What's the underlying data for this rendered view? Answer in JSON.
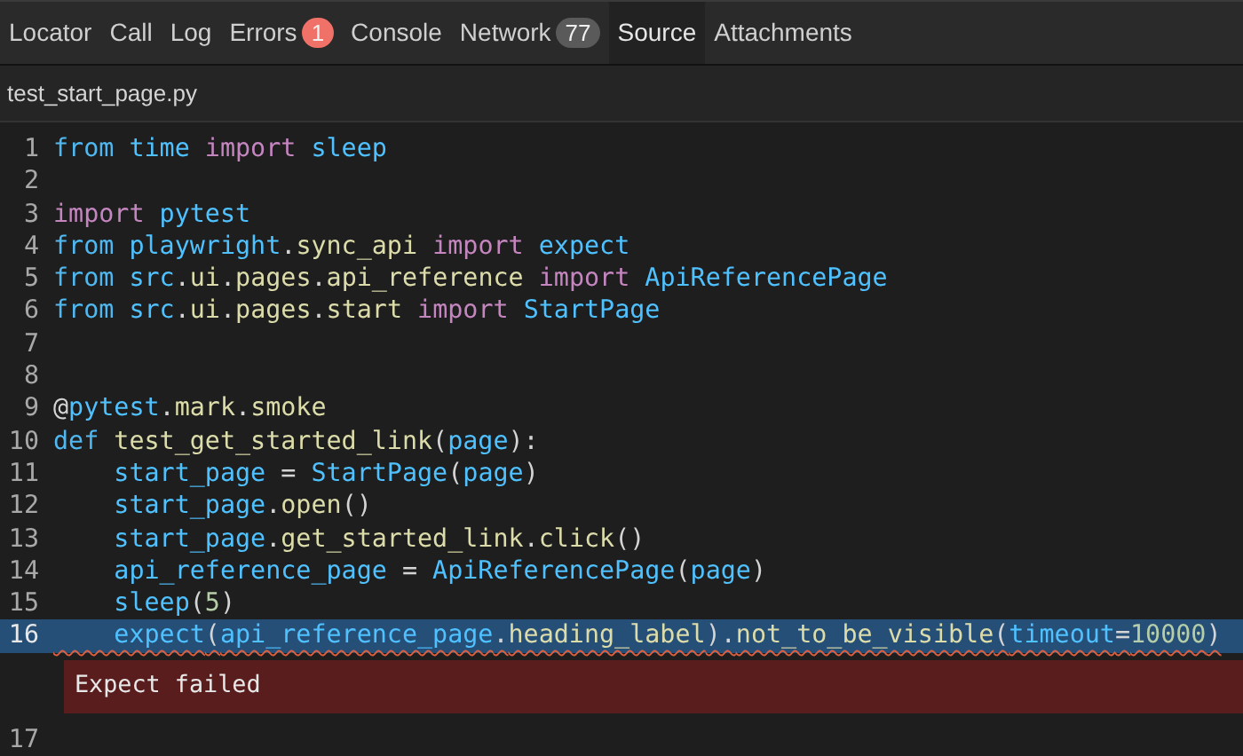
{
  "tabs": [
    {
      "label": "Locator",
      "selected": false
    },
    {
      "label": "Call",
      "selected": false
    },
    {
      "label": "Log",
      "selected": false
    },
    {
      "label": "Errors",
      "selected": false,
      "badge": {
        "text": "1",
        "color": "#f07167"
      }
    },
    {
      "label": "Console",
      "selected": false
    },
    {
      "label": "Network",
      "selected": false,
      "badge": {
        "text": "77",
        "color": "#5a5a5a"
      }
    },
    {
      "label": "Source",
      "selected": true
    },
    {
      "label": "Attachments",
      "selected": false
    }
  ],
  "file_name": "test_start_page.py",
  "lines": [
    {
      "number": "1",
      "highlighted": false,
      "tokens": [
        {
          "kind": "kw",
          "text": "from"
        },
        {
          "kind": "id",
          "text": " time"
        },
        {
          "kind": "imp",
          "text": " import"
        },
        {
          "kind": "id",
          "text": " sleep"
        }
      ]
    },
    {
      "number": "2",
      "highlighted": false
    },
    {
      "number": "3",
      "highlighted": false,
      "tokens": [
        {
          "kind": "imp",
          "text": "import"
        },
        {
          "kind": "id",
          "text": " pytest"
        }
      ]
    },
    {
      "number": "4",
      "highlighted": false,
      "tokens": [
        {
          "kind": "kw",
          "text": "from"
        },
        {
          "kind": "id",
          "text": " playwright"
        },
        {
          "kind": "plain",
          "text": "."
        },
        {
          "kind": "fn",
          "text": "sync_api"
        },
        {
          "kind": "imp",
          "text": " import"
        },
        {
          "kind": "id",
          "text": " expect"
        }
      ]
    },
    {
      "number": "5",
      "highlighted": false,
      "tokens": [
        {
          "kind": "kw",
          "text": "from"
        },
        {
          "kind": "id",
          "text": " src"
        },
        {
          "kind": "plain",
          "text": "."
        },
        {
          "kind": "fn",
          "text": "ui"
        },
        {
          "kind": "plain",
          "text": "."
        },
        {
          "kind": "fn",
          "text": "pages"
        },
        {
          "kind": "plain",
          "text": "."
        },
        {
          "kind": "fn",
          "text": "api_reference"
        },
        {
          "kind": "imp",
          "text": " import"
        },
        {
          "kind": "id",
          "text": " ApiReferencePage"
        }
      ]
    },
    {
      "number": "6",
      "highlighted": false,
      "tokens": [
        {
          "kind": "kw",
          "text": "from"
        },
        {
          "kind": "id",
          "text": " src"
        },
        {
          "kind": "plain",
          "text": "."
        },
        {
          "kind": "fn",
          "text": "ui"
        },
        {
          "kind": "plain",
          "text": "."
        },
        {
          "kind": "fn",
          "text": "pages"
        },
        {
          "kind": "plain",
          "text": "."
        },
        {
          "kind": "fn",
          "text": "start"
        },
        {
          "kind": "imp",
          "text": " import"
        },
        {
          "kind": "id",
          "text": " StartPage"
        }
      ]
    },
    {
      "number": "7",
      "highlighted": false
    },
    {
      "number": "8",
      "highlighted": false
    },
    {
      "number": "9",
      "highlighted": false,
      "tokens": [
        {
          "kind": "plain",
          "text": "@"
        },
        {
          "kind": "id",
          "text": "pytest"
        },
        {
          "kind": "plain",
          "text": "."
        },
        {
          "kind": "fn",
          "text": "mark"
        },
        {
          "kind": "plain",
          "text": "."
        },
        {
          "kind": "fn",
          "text": "smoke"
        }
      ]
    },
    {
      "number": "10",
      "highlighted": false,
      "tokens": [
        {
          "kind": "kw",
          "text": "def"
        },
        {
          "kind": "fn",
          "text": " test_get_started_link"
        },
        {
          "kind": "plain",
          "text": "("
        },
        {
          "kind": "id",
          "text": "page"
        },
        {
          "kind": "plain",
          "text": "):"
        }
      ]
    },
    {
      "number": "11",
      "highlighted": false,
      "tokens": [
        {
          "kind": "id",
          "text": "    start_page"
        },
        {
          "kind": "plain",
          "text": " ="
        },
        {
          "kind": "id",
          "text": " StartPage"
        },
        {
          "kind": "plain",
          "text": "("
        },
        {
          "kind": "id",
          "text": "page"
        },
        {
          "kind": "plain",
          "text": ")"
        }
      ]
    },
    {
      "number": "12",
      "highlighted": false,
      "tokens": [
        {
          "kind": "id",
          "text": "    start_page"
        },
        {
          "kind": "plain",
          "text": "."
        },
        {
          "kind": "fn",
          "text": "open"
        },
        {
          "kind": "plain",
          "text": "()"
        }
      ]
    },
    {
      "number": "13",
      "highlighted": false,
      "tokens": [
        {
          "kind": "id",
          "text": "    start_page"
        },
        {
          "kind": "plain",
          "text": "."
        },
        {
          "kind": "fn",
          "text": "get_started_link"
        },
        {
          "kind": "plain",
          "text": "."
        },
        {
          "kind": "fn",
          "text": "click"
        },
        {
          "kind": "plain",
          "text": "()"
        }
      ]
    },
    {
      "number": "14",
      "highlighted": false,
      "tokens": [
        {
          "kind": "id",
          "text": "    api_reference_page"
        },
        {
          "kind": "plain",
          "text": " ="
        },
        {
          "kind": "id",
          "text": " ApiReferencePage"
        },
        {
          "kind": "plain",
          "text": "("
        },
        {
          "kind": "id",
          "text": "page"
        },
        {
          "kind": "plain",
          "text": ")"
        }
      ]
    },
    {
      "number": "15",
      "highlighted": false,
      "tokens": [
        {
          "kind": "id",
          "text": "    sleep"
        },
        {
          "kind": "plain",
          "text": "("
        },
        {
          "kind": "num",
          "text": "5"
        },
        {
          "kind": "plain",
          "text": ")"
        }
      ]
    },
    {
      "number": "16",
      "highlighted": true,
      "error": "Expect failed",
      "tokens": [
        {
          "kind": "id",
          "text": "    expect"
        },
        {
          "kind": "plain",
          "text": "("
        },
        {
          "kind": "id",
          "text": "api_reference_page"
        },
        {
          "kind": "plain",
          "text": "."
        },
        {
          "kind": "fn",
          "text": "heading_label"
        },
        {
          "kind": "plain",
          "text": ")."
        },
        {
          "kind": "fn",
          "text": "not_to_be_visible"
        },
        {
          "kind": "plain",
          "text": "("
        },
        {
          "kind": "id",
          "text": "timeout"
        },
        {
          "kind": "plain",
          "text": "="
        },
        {
          "kind": "num",
          "text": "10000"
        },
        {
          "kind": "plain",
          "text": ")"
        }
      ]
    },
    {
      "number": "17",
      "highlighted": false
    }
  ]
}
